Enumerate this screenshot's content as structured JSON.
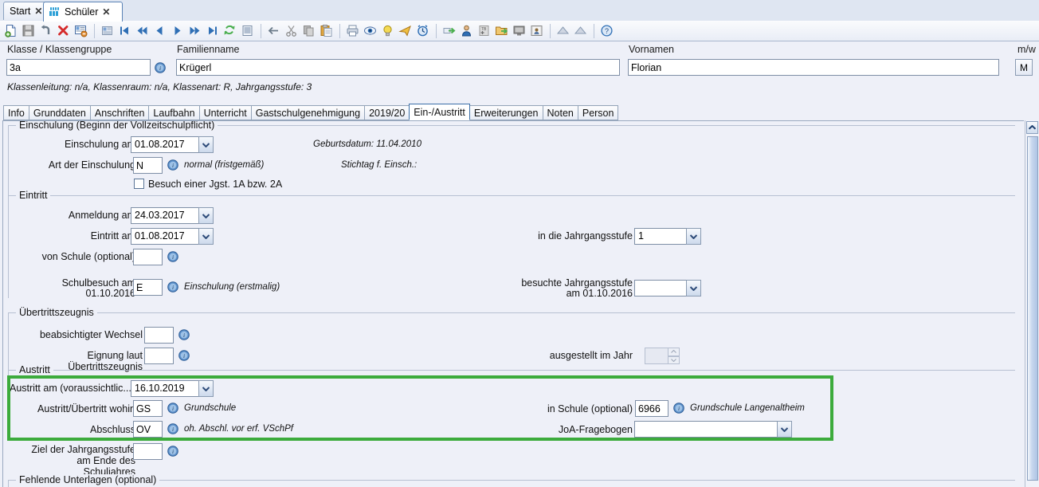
{
  "window_tabs": [
    {
      "label": "Start",
      "icon": null,
      "active": false
    },
    {
      "label": "Schüler",
      "icon": "students-group-icon",
      "active": true
    }
  ],
  "toolbar": {
    "buttons": [
      {
        "name": "new-record-icon",
        "title": "Neu"
      },
      {
        "name": "save-icon",
        "title": "Speichern"
      },
      {
        "name": "undo-icon",
        "title": "Rückgängig"
      },
      {
        "name": "delete-icon",
        "title": "Löschen"
      },
      {
        "name": "cancel-edit-icon",
        "title": "Abbrechen"
      },
      {
        "name": "separator",
        "title": ""
      },
      {
        "name": "list-view-icon",
        "title": "Liste"
      },
      {
        "name": "first-record-icon",
        "title": "Erster"
      },
      {
        "name": "fast-back-icon",
        "title": "Schnell zurück"
      },
      {
        "name": "previous-record-icon",
        "title": "Vorheriger"
      },
      {
        "name": "next-record-icon",
        "title": "Nächster"
      },
      {
        "name": "fast-forward-icon",
        "title": "Schnell vor"
      },
      {
        "name": "last-record-icon",
        "title": "Letzter"
      },
      {
        "name": "refresh-icon",
        "title": "Aktualisieren"
      },
      {
        "name": "report-icon",
        "title": "Bericht"
      },
      {
        "name": "separator",
        "title": ""
      },
      {
        "name": "back-arrow-icon",
        "title": "Zurück"
      },
      {
        "name": "cut-icon",
        "title": "Ausschneiden"
      },
      {
        "name": "copy-icon",
        "title": "Kopieren"
      },
      {
        "name": "paste-icon",
        "title": "Einfügen"
      },
      {
        "name": "separator",
        "title": ""
      },
      {
        "name": "print-icon",
        "title": "Drucken"
      },
      {
        "name": "print-preview-icon",
        "title": "Seitenansicht"
      },
      {
        "name": "hint-bulb-icon",
        "title": "Hinweis"
      },
      {
        "name": "send-icon",
        "title": "Senden"
      },
      {
        "name": "alarm-clock-icon",
        "title": "Termine"
      },
      {
        "name": "separator",
        "title": ""
      },
      {
        "name": "export-icon",
        "title": "Export"
      },
      {
        "name": "person-icon",
        "title": "Person"
      },
      {
        "name": "tb-plus-icon",
        "title": "TB"
      },
      {
        "name": "folder-export-icon",
        "title": "Ordner"
      },
      {
        "name": "monitor-icon",
        "title": "Bildschirm"
      },
      {
        "name": "photo-person-icon",
        "title": "Foto"
      },
      {
        "name": "separator",
        "title": ""
      },
      {
        "name": "up-chevron-icon",
        "title": "Nach oben"
      },
      {
        "name": "up-chevron2-icon",
        "title": "Nach oben"
      },
      {
        "name": "separator",
        "title": ""
      },
      {
        "name": "help-icon",
        "title": "Hilfe"
      }
    ]
  },
  "header": {
    "klasse_label": "Klasse / Klassengruppe",
    "klasse_value": "3a",
    "familienname_label": "Familienname",
    "familienname_value": "Krügerl",
    "vornamen_label": "Vornamen",
    "vornamen_value": "Florian",
    "mw_label": "m/w",
    "mw_value": "M",
    "class_info": "Klassenleitung: n/a, Klassenraum: n/a, Klassenart: R, Jahrgangsstufe: 3"
  },
  "inner_tabs": [
    {
      "label": "Info",
      "active": false
    },
    {
      "label": "Grunddaten",
      "active": false
    },
    {
      "label": "Anschriften",
      "active": false
    },
    {
      "label": "Laufbahn",
      "active": false
    },
    {
      "label": "Unterricht",
      "active": false
    },
    {
      "label": "Gastschulgenehmigung",
      "active": false
    },
    {
      "label": "2019/20",
      "active": false
    },
    {
      "label": "Ein-/Austritt",
      "active": true
    },
    {
      "label": "Erweiterungen",
      "active": false
    },
    {
      "label": "Noten",
      "active": false
    },
    {
      "label": "Person",
      "active": false
    }
  ],
  "einschulung": {
    "group_title": "Einschulung (Beginn der Vollzeitschulpflicht)",
    "einschulung_am_label": "Einschulung am",
    "einschulung_am_value": "01.08.2017",
    "art_label": "Art der Einschulung",
    "art_value": "N",
    "art_note": "normal (fristgemäß)",
    "geburtsdatum_note": "Geburtsdatum: 11.04.2010",
    "stichtag_note": "Stichtag f. Einsch.:",
    "checkbox_label": "Besuch einer Jgst. 1A bzw. 2A",
    "checkbox_checked": false
  },
  "eintritt": {
    "group_title": "Eintritt",
    "anmeldung_label": "Anmeldung am",
    "anmeldung_value": "24.03.2017",
    "eintritt_label": "Eintritt am",
    "eintritt_value": "01.08.2017",
    "von_schule_label": "von Schule (optional)",
    "von_schule_value": "",
    "schulbesuch_label_1": "Schulbesuch am",
    "schulbesuch_label_2": "01.10.2016",
    "schulbesuch_value": "E",
    "schulbesuch_note": "Einschulung (erstmalig)",
    "jahrgangsstufe_label": "in die Jahrgangsstufe",
    "jahrgangsstufe_value": "1",
    "besuchte_label_1": "besuchte Jahrgangsstufe",
    "besuchte_label_2": "am 01.10.2016",
    "besuchte_value": ""
  },
  "uebertritt": {
    "group_title": "Übertrittszeugnis",
    "wechsel_label": "beabsichtigter Wechsel",
    "wechsel_value": "",
    "eignung_label": "Eignung laut Übertrittszeugnis",
    "eignung_value": "",
    "jahr_label": "ausgestellt im Jahr",
    "jahr_value": ""
  },
  "austritt": {
    "group_title": "Austritt",
    "austritt_am_label": "Austritt am (voraussichtlic...",
    "austritt_am_value": "16.10.2019",
    "wohin_label": "Austritt/Übertritt wohin",
    "wohin_value": "GS",
    "wohin_note": "Grundschule",
    "abschluss_label": "Abschluss",
    "abschluss_value": "OV",
    "abschluss_note": "oh. Abschl. vor erf. VSchPf",
    "in_schule_label": "in Schule (optional)",
    "in_schule_value": "6966",
    "in_schule_note": "Grundschule Langenaltheim",
    "joa_label": "JoA-Fragebogen",
    "joa_value": "",
    "highlight_color": "#3cab3c"
  },
  "ziel": {
    "label_1": "Ziel der Jahrgangsstufe",
    "label_2": "am Ende des",
    "label_3": "Schuljahres",
    "value": ""
  },
  "fehlende": {
    "group_title": "Fehlende Unterlagen (optional)"
  },
  "scrollbar": {
    "up_arrow": "scroll-up-icon"
  }
}
